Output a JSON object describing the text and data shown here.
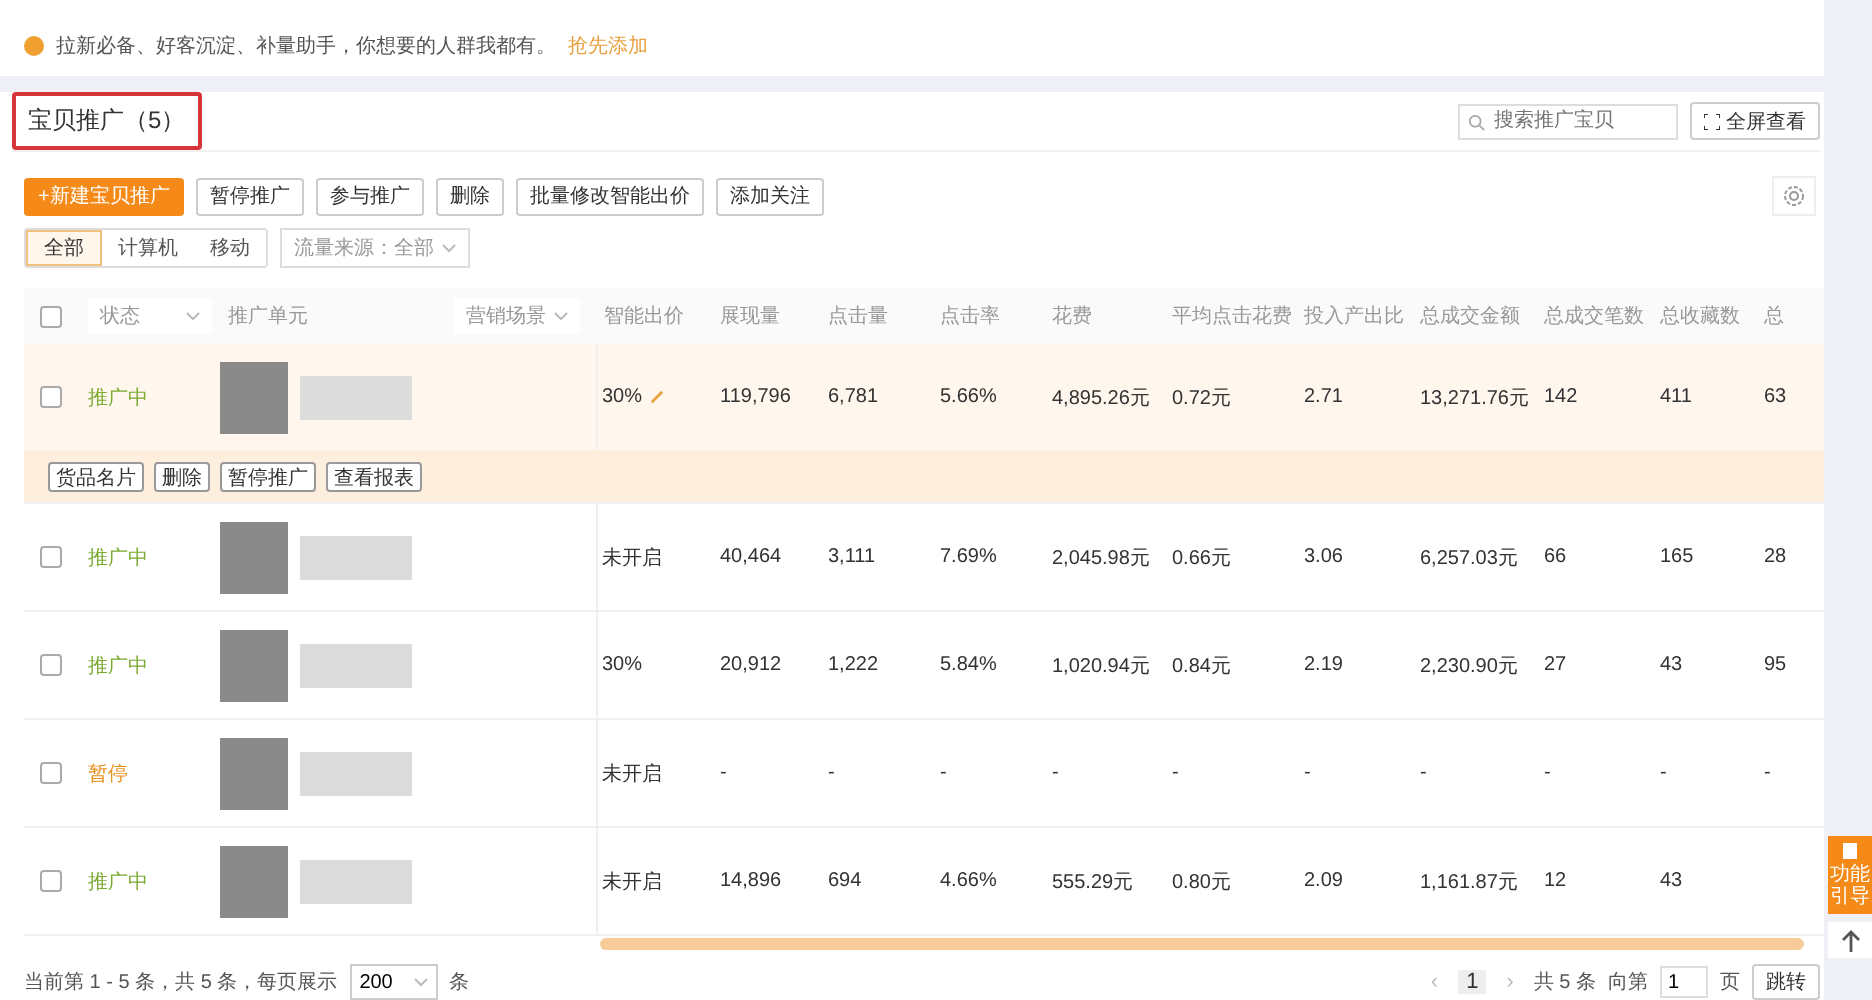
{
  "notice": {
    "text": "拉新必备、好客沉淀、补量助手，你想要的人群我都有。",
    "link": "抢先添加"
  },
  "section": {
    "title": "宝贝推广（5）",
    "search": {
      "placeholder": "搜索推广宝贝"
    },
    "fullscreen": "全屏查看"
  },
  "toolbar": [
    {
      "label": "+新建宝贝推广",
      "kind": "primary"
    },
    {
      "label": "暂停推广",
      "kind": "default"
    },
    {
      "label": "参与推广",
      "kind": "default"
    },
    {
      "label": "删除",
      "kind": "default"
    },
    {
      "label": "批量修改智能出价",
      "kind": "default"
    },
    {
      "label": "添加关注",
      "kind": "default"
    }
  ],
  "device_tabs": [
    {
      "label": "全部",
      "selected": true
    },
    {
      "label": "计算机",
      "selected": false
    },
    {
      "label": "移动",
      "selected": false
    }
  ],
  "traffic_filter": "流量来源：全部",
  "table": {
    "select_all_checked": false,
    "fixed_columns": [
      {
        "label": "状态",
        "dropdown": true
      },
      {
        "label": "推广单元",
        "filter": "营销场景"
      },
      {
        "label": "智能出价",
        "dropdown": false
      }
    ],
    "columns": [
      "展现量",
      "点击量",
      "点击率",
      "花费",
      "平均点击花费",
      "投入产出比",
      "总成交金额",
      "总成交笔数",
      "总收藏数",
      "总"
    ],
    "rows": [
      {
        "checked": false,
        "expanded": true,
        "status": "推广中",
        "kind": "active",
        "bid": "30%",
        "editable": true,
        "cells": [
          "119,796",
          "6,781",
          "5.66%",
          "4,895.26元",
          "0.72元",
          "2.71",
          "13,271.76元",
          "142",
          "411",
          "63"
        ],
        "actions": [
          "货品名片",
          "删除",
          "暂停推广",
          "查看报表"
        ]
      },
      {
        "checked": false,
        "expanded": false,
        "status": "推广中",
        "kind": "active",
        "bid": "未开启",
        "editable": false,
        "cells": [
          "40,464",
          "3,111",
          "7.69%",
          "2,045.98元",
          "0.66元",
          "3.06",
          "6,257.03元",
          "66",
          "165",
          "28"
        ]
      },
      {
        "checked": false,
        "expanded": false,
        "status": "推广中",
        "kind": "active",
        "bid": "30%",
        "editable": false,
        "cells": [
          "20,912",
          "1,222",
          "5.84%",
          "1,020.94元",
          "0.84元",
          "2.19",
          "2,230.90元",
          "27",
          "43",
          "95"
        ]
      },
      {
        "checked": false,
        "expanded": false,
        "status": "暂停",
        "kind": "paused",
        "bid": "未开启",
        "editable": false,
        "cells": [
          "-",
          "-",
          "-",
          "-",
          "-",
          "-",
          "-",
          "-",
          "-",
          "-"
        ]
      },
      {
        "checked": false,
        "expanded": false,
        "status": "推广中",
        "kind": "active",
        "bid": "未开启",
        "editable": false,
        "cells": [
          "14,896",
          "694",
          "4.66%",
          "555.29元",
          "0.80元",
          "2.09",
          "1,161.87元",
          "12",
          "43"
        ]
      }
    ]
  },
  "footer": {
    "summary": "当前第 1 - 5 条，共 5 条，每页展示",
    "page_size": "200",
    "unit": "条",
    "prev": "‹",
    "page": "1",
    "next": "›",
    "total": "共 5 条",
    "goto_prefix": "向第",
    "goto_value": "1",
    "goto_suffix": "页",
    "goto_button": "跳转"
  },
  "side": {
    "guide": "功能引导"
  }
}
